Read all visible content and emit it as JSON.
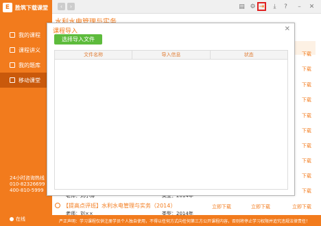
{
  "app": {
    "logo_char": "E",
    "logo_text": "胜筑下载课堂",
    "logo_sub": ""
  },
  "sidebar": {
    "items": [
      {
        "label": "我的课程",
        "active": false
      },
      {
        "label": "课程讲义",
        "active": false
      },
      {
        "label": "我的题库",
        "active": false
      },
      {
        "label": "移动课堂",
        "active": true
      }
    ],
    "contact_line1": "24小时咨询热线",
    "contact_line2": "010-82326699",
    "contact_line3": "400-810-5999",
    "online_label": "在线"
  },
  "page": {
    "title": "水利水电管理与实务"
  },
  "row_actions": [
    "下载",
    "下载",
    "下载",
    "下载",
    "下载",
    "下载",
    "下载",
    "下载",
    "下载",
    "下载",
    "下载"
  ],
  "course": {
    "title": "【提高点评班】水利水电管理与实务（2014）",
    "teacher": "老师：刘小博",
    "teacher2": "老师：刘××",
    "type": "类型：2014年",
    "type2": "类型：2014年",
    "actions": [
      "立即下载",
      "立即下载",
      "立即下载"
    ]
  },
  "footer": {
    "text": "严正声明：学习课程仅供注册学员个人独自使用，不得以任何方式向任何第三方公开课程内容，否则将停止学习权限并追究违规法律责任！"
  },
  "dialog": {
    "title": "课程导入",
    "import_button": "选择导入文件",
    "columns": [
      "文件名称",
      "导入信息",
      "状态"
    ]
  },
  "colors": {
    "accent": "#f27b1d",
    "green": "#5dbb3c"
  }
}
